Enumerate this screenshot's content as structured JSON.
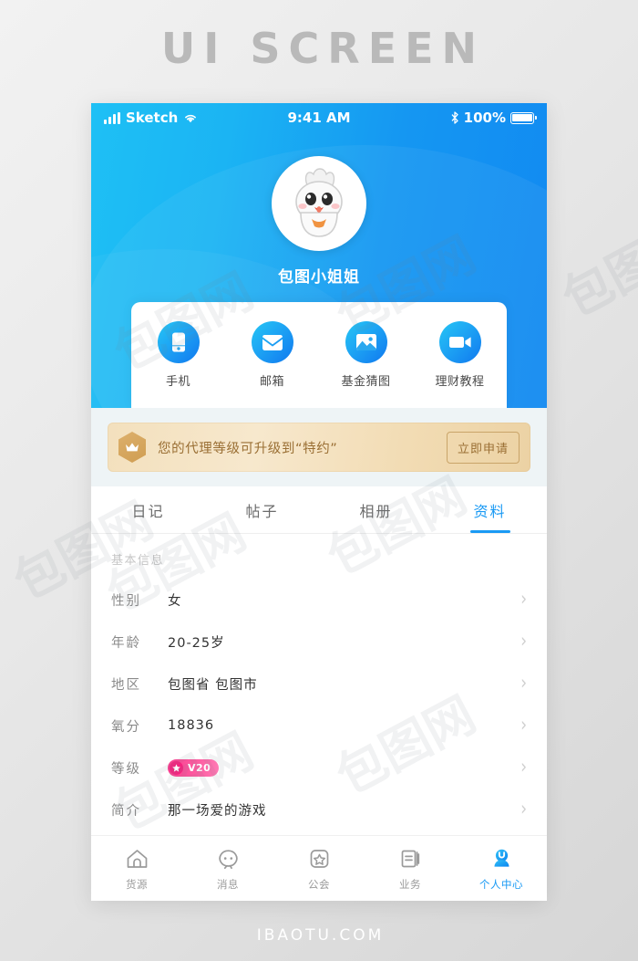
{
  "page": {
    "title": "UI SCREEN",
    "footer": "IBAOTU.COM",
    "watermark": "包图网"
  },
  "statusbar": {
    "carrier": "Sketch",
    "time": "9:41 AM",
    "battery": "100%",
    "icons": {
      "signal": "signal-bars-icon",
      "wifi": "wifi-icon",
      "bluetooth": "bluetooth-icon",
      "battery": "battery-icon"
    }
  },
  "profile": {
    "username": "包图小姐姐",
    "avatar": "cartoon-bunny-avatar"
  },
  "quick_actions": [
    {
      "label": "手机",
      "icon": "phone-icon"
    },
    {
      "label": "邮箱",
      "icon": "envelope-icon"
    },
    {
      "label": "基金猜图",
      "icon": "image-icon"
    },
    {
      "label": "理财教程",
      "icon": "video-camera-icon"
    }
  ],
  "banner": {
    "icon": "crown-hex-badge-icon",
    "text": "您的代理等级可升级到“特约”",
    "button": "立即申请"
  },
  "tabs": [
    {
      "label": "日记",
      "active": false
    },
    {
      "label": "帖子",
      "active": false
    },
    {
      "label": "相册",
      "active": false
    },
    {
      "label": "资料",
      "active": true
    }
  ],
  "info": {
    "section_title": "基本信息",
    "rows": [
      {
        "label": "性别",
        "value": "女",
        "type": "text"
      },
      {
        "label": "年龄",
        "value": "20-25岁",
        "type": "text"
      },
      {
        "label": "地区",
        "value": "包图省 包图市",
        "type": "text"
      },
      {
        "label": "氧分",
        "value": "18836",
        "type": "text"
      },
      {
        "label": "等级",
        "value": "V20",
        "type": "badge"
      },
      {
        "label": "简介",
        "value": "那一场爱的游戏",
        "type": "text"
      }
    ],
    "chevron": "chevron-right-icon"
  },
  "bottom_nav": [
    {
      "label": "货源",
      "icon": "home-icon",
      "active": false
    },
    {
      "label": "消息",
      "icon": "message-icon",
      "active": false
    },
    {
      "label": "公会",
      "icon": "star-square-icon",
      "active": false
    },
    {
      "label": "业务",
      "icon": "list-book-icon",
      "active": false
    },
    {
      "label": "个人中心",
      "icon": "person-icon",
      "active": true
    }
  ],
  "colors": {
    "header_start": "#1ec0f5",
    "header_end": "#1189f1",
    "accent": "#1a9af4",
    "banner_gold": "#f2dcb4",
    "banner_text": "#9a6f34",
    "badge_pink": "#fb3c8f"
  }
}
